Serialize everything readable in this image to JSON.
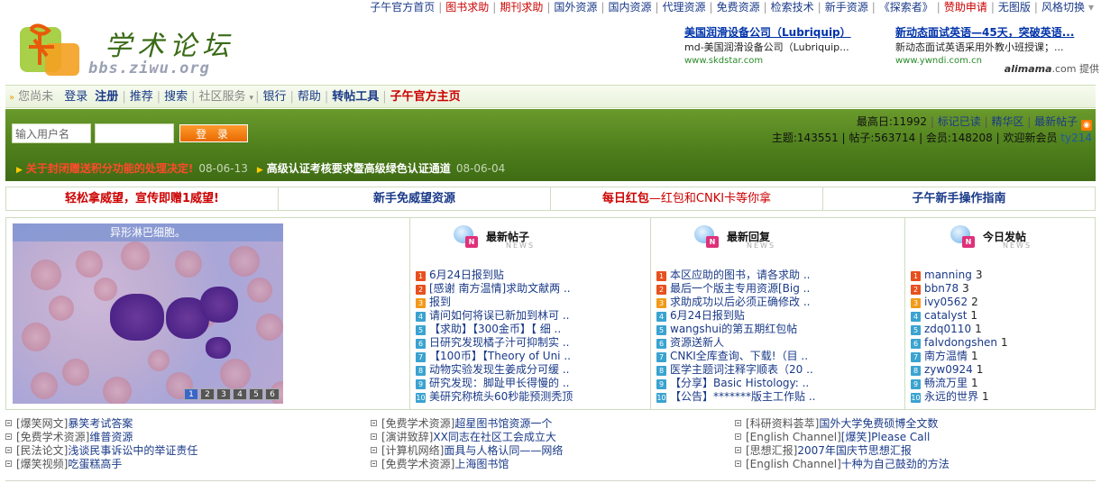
{
  "topbar": {
    "links": [
      {
        "label": "子午官方首页",
        "red": false
      },
      {
        "label": "图书求助",
        "red": true
      },
      {
        "label": "期刊求助",
        "red": true
      },
      {
        "label": "国外资源",
        "red": false
      },
      {
        "label": "国内资源",
        "red": false
      },
      {
        "label": "代理资源",
        "red": false
      },
      {
        "label": "免费资源",
        "red": false
      },
      {
        "label": "检索技术",
        "red": false
      },
      {
        "label": "新手资源",
        "red": false
      },
      {
        "label": "《探索者》",
        "red": false
      },
      {
        "label": "赞助申请",
        "red": true
      },
      {
        "label": "无图版",
        "red": false
      },
      {
        "label": "风格切换",
        "red": false
      }
    ],
    "dropdown_arrow": "▾"
  },
  "header": {
    "logo_cn": "学术论坛",
    "logo_en": "bbs.ziwu.org"
  },
  "ad": {
    "col1": {
      "title": "美国润滑设备公司（Lubriquip）",
      "desc": "md-美国润滑设备公司（Lubriquip...",
      "url": "www.skdstar.com"
    },
    "col2": {
      "title": "新动态面试英语—45天，突破英语...",
      "desc": "新动态面试英语采用外教小班授课；...",
      "url": "www.ywndi.com.cn"
    },
    "provider_brand": "alimama",
    "provider_suffix": ".com 提供"
  },
  "nav": {
    "guest": "您尚未",
    "items": [
      {
        "label": "登录",
        "style": "normal"
      },
      {
        "label": "注册",
        "style": "bold"
      },
      {
        "label": "推荐",
        "style": "normal"
      },
      {
        "label": "搜索",
        "style": "normal"
      },
      {
        "label": "社区服务",
        "style": "gray",
        "dropdown": true
      },
      {
        "label": "银行",
        "style": "normal"
      },
      {
        "label": "帮助",
        "style": "normal"
      },
      {
        "label": "转帖工具",
        "style": "bold"
      },
      {
        "label": "子午官方主页",
        "style": "red"
      }
    ]
  },
  "login": {
    "username_value": "输入用户名",
    "password_value": "",
    "submit_label": "登 录"
  },
  "stats": {
    "max_day": "最高日:11992",
    "links": [
      "标记已读",
      "精华区",
      "最新帖子"
    ],
    "line2_prefix": "主题:143551 | 帖子:563714 | 会员:148208 | 欢迎新会员",
    "new_member": "ty214",
    "rss_icon": "rss-icon"
  },
  "notices": [
    {
      "title": "关于封闭赠送积分功能的处理决定!",
      "date": "08-06-13",
      "style": "red"
    },
    {
      "title": "高级认证考核要求暨高级绿色认证通道",
      "date": "08-06-04",
      "style": "white"
    }
  ],
  "promo": [
    {
      "parts": [
        {
          "text": "轻松拿威望，宣传即赠1威望!",
          "style": "red"
        }
      ]
    },
    {
      "parts": [
        {
          "text": "新手免威望资源",
          "style": "blue"
        }
      ]
    },
    {
      "parts": [
        {
          "text": "每日红包",
          "style": "red"
        },
        {
          "text": "—红包和CNKI卡等你拿",
          "style": "red-normal"
        }
      ]
    },
    {
      "parts": [
        {
          "text": "子午新手操作指南",
          "style": "blue"
        }
      ]
    }
  ],
  "slideshow": {
    "title": "异形淋巴细胞。",
    "pages": [
      "1",
      "2",
      "3",
      "4",
      "5",
      "6"
    ],
    "active_page": 0
  },
  "latest_posts": {
    "title": "最新帖子",
    "subtitle": "NEWS",
    "items": [
      "6月24日报到贴",
      "[感谢 南方温情]求助文献两 ..",
      "报到",
      "请问如何将误已新加到林可 ..",
      "【求助】【300金币】【 细 ..",
      "日研究发现橘子汁可抑制实 ..",
      "【100币】【Theory of Uni ..",
      "动物实验发现生姜成分可缓 ..",
      "研究发现：脚趾甲长得慢的 ..",
      "美研究称梳头60秒能预测秃顶"
    ]
  },
  "latest_replies": {
    "title": "最新回复",
    "subtitle": "NEWS",
    "items": [
      "本区应助的图书，请各求助 ..",
      "最后一个版主专用资源[Big ..",
      "求助成功以后必须正确修改 ..",
      "6月24日报到贴",
      "wangshui的第五期红包帖",
      "资源送新人",
      "CNKI全库查询、下载!（目 ..",
      "医学主题词注释字顺表（20 ..",
      "【分享】Basic Histology: ..",
      "【公告】*******版主工作贴 .."
    ]
  },
  "today_posters": {
    "title": "今日发帖",
    "subtitle": "NEWS",
    "items": [
      {
        "name": "manning",
        "count": "3"
      },
      {
        "name": "bbn78",
        "count": "3"
      },
      {
        "name": "ivy0562",
        "count": "2"
      },
      {
        "name": "catalyst",
        "count": "1"
      },
      {
        "name": "zdq0110",
        "count": "1"
      },
      {
        "name": "falvdongshen",
        "count": "1"
      },
      {
        "name": "南方温情",
        "count": "1"
      },
      {
        "name": "zyw0924",
        "count": "1"
      },
      {
        "name": "畅流万里",
        "count": "1"
      },
      {
        "name": "永远的世界",
        "count": "1"
      }
    ]
  },
  "bottom_links": [
    [
      {
        "cat": "[爆笑网文]",
        "title": "暴笑考试答案"
      },
      {
        "cat": "[免费学术资源]",
        "title": "维普资源"
      },
      {
        "cat": "[民法论文]",
        "title": "浅谈民事诉讼中的举证责任"
      },
      {
        "cat": "[爆笑视频]",
        "title": "吃蛋糕高手"
      }
    ],
    [
      {
        "cat": "[免费学术资源]",
        "title": "超星图书馆资源一个"
      },
      {
        "cat": "[演讲致辞]",
        "title": "XX同志在社区工会成立大"
      },
      {
        "cat": "[计算机网络]",
        "title": "面具与人格认同——网络"
      },
      {
        "cat": "[免费学术资源]",
        "title": "上海图书馆"
      }
    ],
    [
      {
        "cat": "[科研资料荟萃]",
        "title": "国外大学免费硕博全文数"
      },
      {
        "cat": "[English Channel]",
        "title": "[爆笑]Please Call"
      },
      {
        "cat": "[思想汇报]",
        "title": "2007年国庆节思想汇报"
      },
      {
        "cat": "[English Channel]",
        "title": "十种为自己鼓劲的方法"
      }
    ]
  ],
  "colors": {
    "banner_green": "#4e7f1c",
    "link_blue": "#1a3a88",
    "accent_red": "#cc0000",
    "button_orange": "#f08020"
  }
}
